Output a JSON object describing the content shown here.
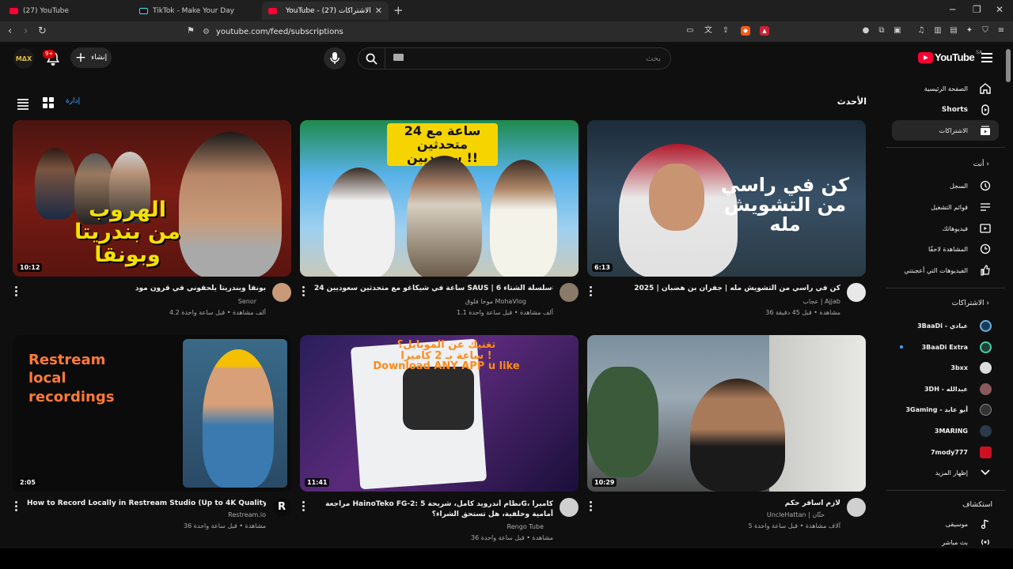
{
  "browser": {
    "tabs": [
      {
        "title": "(27) YouTube",
        "icon": "youtube-favicon"
      },
      {
        "title": "TikTok - Make Your Day",
        "icon": "tiktok-favicon"
      },
      {
        "title": "YouTube - الاشتراكات (27)",
        "icon": "youtube-favicon",
        "active": true
      }
    ],
    "url": "youtube.com/feed/subscriptions",
    "extension_badge": "3"
  },
  "header": {
    "create_label": "إنشاء",
    "notifications_badge": "9+",
    "avatar_text": "MΔX",
    "search_placeholder": "بحث",
    "logo_text": "YouTube",
    "country_code": "SA"
  },
  "feed": {
    "title": "الأحدث",
    "manage_label": "إدارة"
  },
  "videos": [
    {
      "title": "كن في راسي من التشويش مله | جفران بن هضبان | 2025",
      "channel": "عجاب | Ajjab",
      "stats": "36 مشاهدة • قبل 45 دقيقة",
      "duration": "6:13",
      "thumb_text": "كن في راسي\nمن التشويش مله"
    },
    {
      "title": "24 ساعة في شيكاغو مع متحدثين سعوديين SAUS | سلسلة الشتاء 6#",
      "channel": "موحا فلوق MohaVlog",
      "stats": "1.1 ألف مشاهدة • قبل ساعة واحدة",
      "duration": "",
      "thumb_text": "24 ساعة مع\nمتحدثين سعوديين !!"
    },
    {
      "title": "بونقا وبندريتا يلحقوني في قرون مود",
      "channel": "Senor",
      "stats": "4.2 ألف مشاهدة • قبل ساعة واحدة",
      "duration": "10:12",
      "thumb_text": "الهروب\nمن بندريتا وبونقا"
    },
    {
      "title": "لازم اسافر حكم",
      "channel": "UncleHattan | حتّان",
      "stats": "5 آلاف مشاهدة • قبل ساعة واحدة",
      "duration": "10:29",
      "thumb_text": ""
    },
    {
      "title": "مراجعة HainoTeko FG-2: نظام أندرويد كامل، شريحة 5G، كاميرا أمامية وخلفية، هل تستحق الشراء؟",
      "channel": "Rengo Tube",
      "stats": "36 مشاهدة • قبل ساعة واحدة",
      "duration": "11:41",
      "thumb_text": "تغنيك عن الموبايل؟\nساعة بـ 2 كاميرا !\nDownload ANY APP u like"
    },
    {
      "title": "How to Record Locally in Restream Studio (Up to 4K Quality)",
      "channel": "Restream.io",
      "stats": "36 مشاهدة • قبل ساعة واحدة",
      "duration": "2:05",
      "thumb_text": "Restream\nlocal\nrecordings"
    }
  ],
  "sidebar": {
    "main": [
      {
        "label": "الصفحة الرئيسية",
        "icon": "home-icon"
      },
      {
        "label": "Shorts",
        "icon": "shorts-icon"
      },
      {
        "label": "الاشتراكات",
        "icon": "subscriptions-icon",
        "active": true
      }
    ],
    "you_header": "أنت",
    "you": [
      {
        "label": "السجل",
        "icon": "history-icon"
      },
      {
        "label": "قوائم التشغيل",
        "icon": "playlists-icon"
      },
      {
        "label": "فيديوهاتك",
        "icon": "your-videos-icon"
      },
      {
        "label": "المشاهدة لاحقًا",
        "icon": "watch-later-icon"
      },
      {
        "label": "الفيديوهات التي أعجبتني",
        "icon": "liked-icon"
      }
    ],
    "subs_header": "الاشتراكات",
    "subscriptions": [
      {
        "label": "3BaaDi - عبادي",
        "color": "#1a3a5a"
      },
      {
        "label": "3BaaDi Extra",
        "color": "#1f3f3a"
      },
      {
        "label": "3bxx",
        "color": "#dddddd"
      },
      {
        "label": "3DH - عبدالله",
        "color": "#8a5a5a"
      },
      {
        "label": "3Gaming - أبو عابد",
        "color": "#333333"
      },
      {
        "label": "3MARING",
        "color": "#2a3a4a"
      },
      {
        "label": "7mody777",
        "color": "#cc1122"
      }
    ],
    "show_more": "إظهار المزيد",
    "explore_header": "استكشاف",
    "explore": [
      {
        "label": "موسيقى",
        "icon": "music-icon"
      },
      {
        "label": "بث مباشر",
        "icon": "live-icon"
      }
    ]
  }
}
